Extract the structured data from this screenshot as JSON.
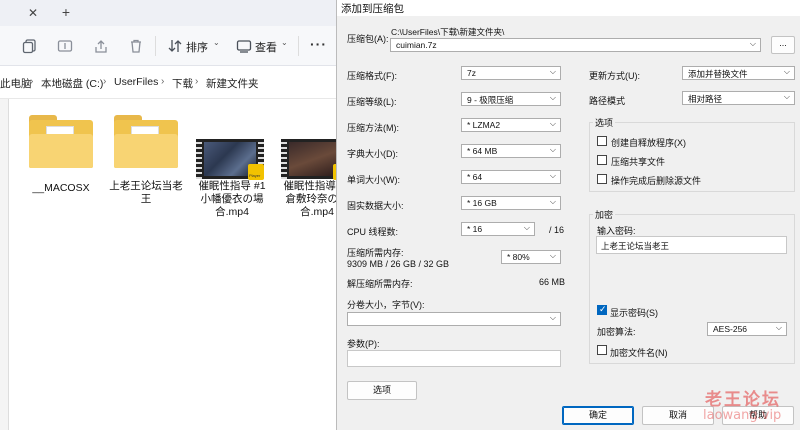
{
  "explorer": {
    "toolbar": {
      "sort_label": "排序",
      "view_label": "查看",
      "more_label": "···"
    },
    "breadcrumb": [
      "此电脑",
      "本地磁盘 (C:)",
      "UserFiles",
      "下载",
      "新建文件夹"
    ],
    "items": [
      {
        "label": "__MACOSX",
        "kind": "folder"
      },
      {
        "label": "上老王论坛当老王",
        "kind": "folder"
      },
      {
        "label": "催眠性指导 #1 小幡優衣の場合.mp4",
        "kind": "video"
      },
      {
        "label": "催眠性指導 #2 倉敷玲奈の場合.mp4",
        "kind": "video"
      }
    ],
    "player_badge": "Player"
  },
  "dialog": {
    "title": "添加到压缩包",
    "archive": {
      "label": "压缩包(A):",
      "path": "C:\\UserFiles\\下载\\新建文件夹\\",
      "value": "cuimian.7z",
      "browse_label": "..."
    },
    "left": {
      "format": {
        "label": "压缩格式(F):",
        "value": "7z"
      },
      "level": {
        "label": "压缩等级(L):",
        "value": "9 - 极限压缩"
      },
      "method": {
        "label": "压缩方法(M):",
        "value": "* LZMA2"
      },
      "dict": {
        "label": "字典大小(D):",
        "value": "* 64 MB"
      },
      "word": {
        "label": "单词大小(W):",
        "value": "* 64"
      },
      "solid": {
        "label": "固实数据大小:",
        "value": "* 16 GB"
      },
      "threads": {
        "label": "CPU 线程数:",
        "value": "* 16",
        "total": "/ 16"
      },
      "memory": {
        "label": "压缩所需内存:",
        "detail": "9309 MB / 26 GB / 32 GB",
        "value": "* 80%"
      },
      "decomp": {
        "label": "解压缩所需内存:",
        "value": "66 MB"
      },
      "split": {
        "label": "分卷大小，字节(V):",
        "value": ""
      },
      "params": {
        "label": "参数(P):",
        "value": ""
      },
      "options_button": "选项"
    },
    "right": {
      "update": {
        "label": "更新方式(U):",
        "value": "添加并替换文件"
      },
      "pathmode": {
        "label": "路径模式",
        "value": "相对路径"
      },
      "options": {
        "title": "选项",
        "sfx": {
          "label": "创建自释放程序(X)",
          "checked": false
        },
        "shared": {
          "label": "压缩共享文件",
          "checked": false
        },
        "delete": {
          "label": "操作完成后删除源文件",
          "checked": false
        }
      },
      "encryption": {
        "title": "加密",
        "pwd_label": "输入密码:",
        "pwd_value": "上老王论坛当老王",
        "show_pwd": {
          "label": "显示密码(S)",
          "checked": true
        },
        "method_label": "加密算法:",
        "method_value": "AES-256",
        "encrypt_names": {
          "label": "加密文件名(N)",
          "checked": false
        }
      }
    },
    "buttons": {
      "ok": "确定",
      "cancel": "取消",
      "help": "帮助"
    }
  },
  "watermark": {
    "line1": "老王论坛",
    "line2": "laowang.vip"
  }
}
